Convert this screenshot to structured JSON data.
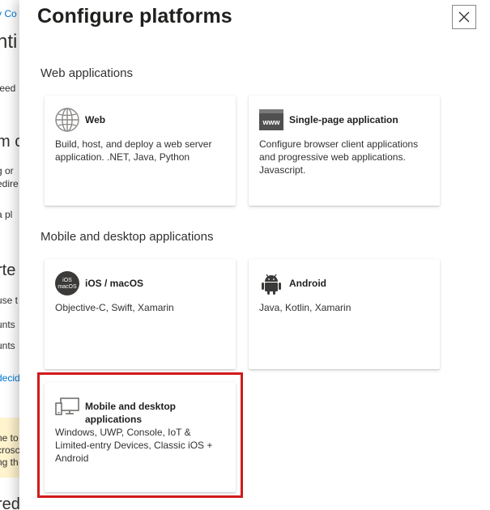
{
  "background_page": {
    "fragments": [
      "y Co",
      "nti",
      "feed",
      "m c",
      "g or",
      "edire",
      "a pl",
      "rte",
      "use t",
      "unts",
      "unts",
      "decid",
      "ne to",
      "crosc",
      "ng th",
      "red"
    ]
  },
  "panel": {
    "title": "Configure platforms",
    "close_label": "×",
    "sections": [
      {
        "title": "Web applications",
        "tiles": [
          {
            "title": "Web",
            "description": "Build, host, and deploy a web server application. .NET, Java, Python",
            "icon": "globe-icon"
          },
          {
            "title": "Single-page application",
            "description": "Configure browser client applications and progressive web applications. Javascript.",
            "icon": "www-icon"
          }
        ]
      },
      {
        "title": "Mobile and desktop applications",
        "tiles": [
          {
            "title": "iOS / macOS",
            "description": "Objective-C, Swift, Xamarin",
            "icon": "ios-macos-icon",
            "icon_text_1": "iOS",
            "icon_text_2": "macOS"
          },
          {
            "title": "Android",
            "description": "Java, Kotlin, Xamarin",
            "icon": "android-icon"
          },
          {
            "title": "Mobile and desktop applications",
            "description": "Windows, UWP, Console, IoT & Limited-entry Devices, Classic iOS + Android",
            "icon": "desktop-monitor-icon",
            "highlighted": true
          }
        ]
      }
    ]
  },
  "colors": {
    "highlight": "#d11a1a",
    "link": "#0078d4",
    "notice_background": "#fff4ce"
  }
}
